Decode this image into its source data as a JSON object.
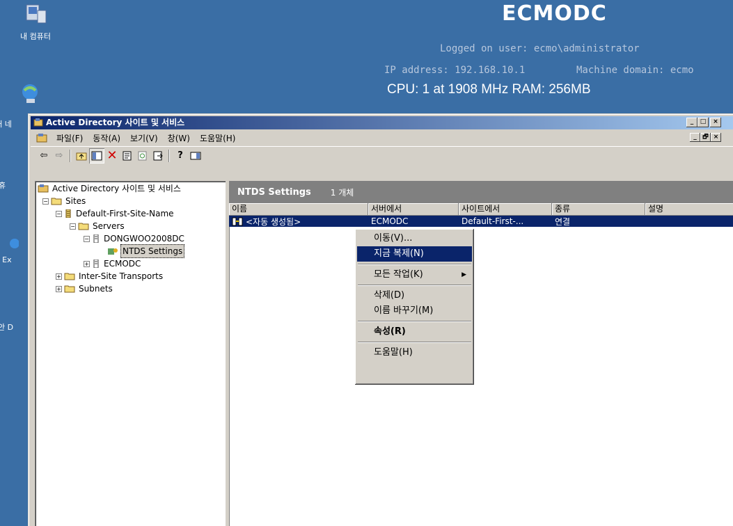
{
  "desktop": {
    "icons": [
      {
        "label": "내 컴퓨터",
        "icon": "computer-icon"
      },
      {
        "label": "내 네",
        "icon": "network-icon"
      },
      {
        "label": "휴",
        "icon": "recycle-icon"
      },
      {
        "label": "In Ex",
        "icon": "ie-icon"
      },
      {
        "label": "보안 D",
        "icon": "security-icon"
      }
    ]
  },
  "bginfo": {
    "hostname": "ECMODC",
    "logged_user": "Logged on user: ecmo\\administrator",
    "ip": "IP address: 192.168.10.1",
    "domain": "Machine domain: ecmo",
    "hardware": "CPU: 1 at 1908 MHz   RAM: 256MB"
  },
  "window": {
    "title": "Active Directory 사이트 및 서비스",
    "caption_buttons": [
      "_",
      "□",
      "×"
    ],
    "mdi_buttons": [
      "_",
      "🗗",
      "×"
    ]
  },
  "menubar": [
    "파일(F)",
    "동작(A)",
    "보기(V)",
    "창(W)",
    "도움말(H)"
  ],
  "toolbar": [
    "back-icon",
    "forward-icon",
    "up-folder-icon",
    "show-tree-icon",
    "delete-icon",
    "properties-icon",
    "refresh-icon",
    "export-icon",
    "help-icon",
    "console-icon"
  ],
  "tree": {
    "root": "Active Directory 사이트 및 서비스",
    "sites": "Sites",
    "site_name": "Default-First-Site-Name",
    "servers": "Servers",
    "server1": "DONGWOO2008DC",
    "ntds": "NTDS Settings",
    "server2": "ECMODC",
    "transports": "Inter-Site Transports",
    "subnets": "Subnets"
  },
  "list": {
    "header_title": "NTDS Settings",
    "header_count": "1 개체",
    "columns": [
      "이름",
      "서버에서",
      "사이트에서",
      "종류",
      "설명"
    ],
    "row": {
      "name": "<자동 생성됨>",
      "from_server": "ECMODC",
      "from_site": "Default-First-...",
      "type": "연결",
      "desc": ""
    }
  },
  "context_menu": {
    "move": "이동(V)...",
    "replicate": "지금 복제(N)",
    "all_tasks": "모든 작업(K)",
    "delete": "삭제(D)",
    "rename": "이름 바꾸기(M)",
    "properties": "속성(R)",
    "help": "도움말(H)"
  },
  "colors": {
    "desktop": "#3A6EA5",
    "selection": "#0A246A",
    "face": "#D4D0C8"
  }
}
